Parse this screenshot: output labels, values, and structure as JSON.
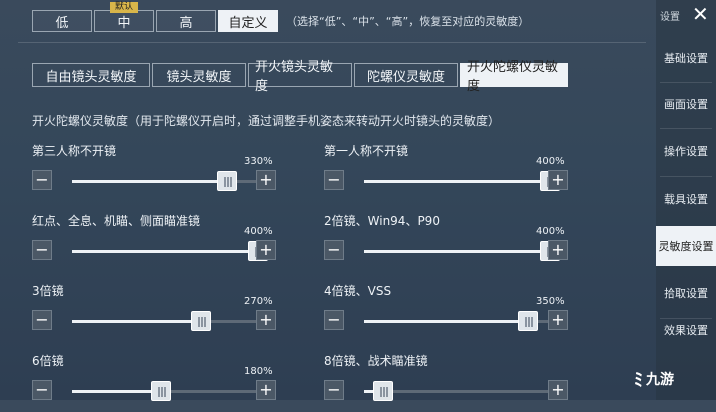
{
  "presets": {
    "default_badge": "默认",
    "buttons": [
      "低",
      "中",
      "高",
      "自定义"
    ],
    "hint": "（选择“低”、“中”、“高”，恢复至对应的灵敏度）"
  },
  "tabs": [
    "自由镜头灵敏度",
    "镜头灵敏度",
    "开火镜头灵敏度",
    "陀螺仪灵敏度",
    "开火陀螺仪灵敏度"
  ],
  "description": "开火陀螺仪灵敏度（用于陀螺仪开启时，通过调整手机姿态来转动开火时镜头的灵敏度）",
  "sliders": [
    {
      "label": "第三人称不开镜",
      "value": "330%",
      "level": 0.825
    },
    {
      "label": "第一人称不开镜",
      "value": "400%",
      "level": 1.0
    },
    {
      "label": "红点、全息、机瞄、侧面瞄准镜",
      "value": "400%",
      "level": 1.0
    },
    {
      "label": "2倍镜、Win94、P90",
      "value": "400%",
      "level": 1.0
    },
    {
      "label": "3倍镜",
      "value": "270%",
      "level": 0.675
    },
    {
      "label": "4倍镜、VSS",
      "value": "350%",
      "level": 0.875
    },
    {
      "label": "6倍镜",
      "value": "180%",
      "level": 0.45
    },
    {
      "label": "8倍镜、战术瞄准镜",
      "value": "",
      "level": 0.05
    }
  ],
  "controls": {
    "minus": "−",
    "plus": "+"
  },
  "sidebar": {
    "title": "设置",
    "close": "✕",
    "items": [
      "基础设置",
      "画面设置",
      "操作设置",
      "载具设置",
      "灵敏度设置",
      "拾取设置",
      "效果设置"
    ]
  },
  "watermark": "九游"
}
